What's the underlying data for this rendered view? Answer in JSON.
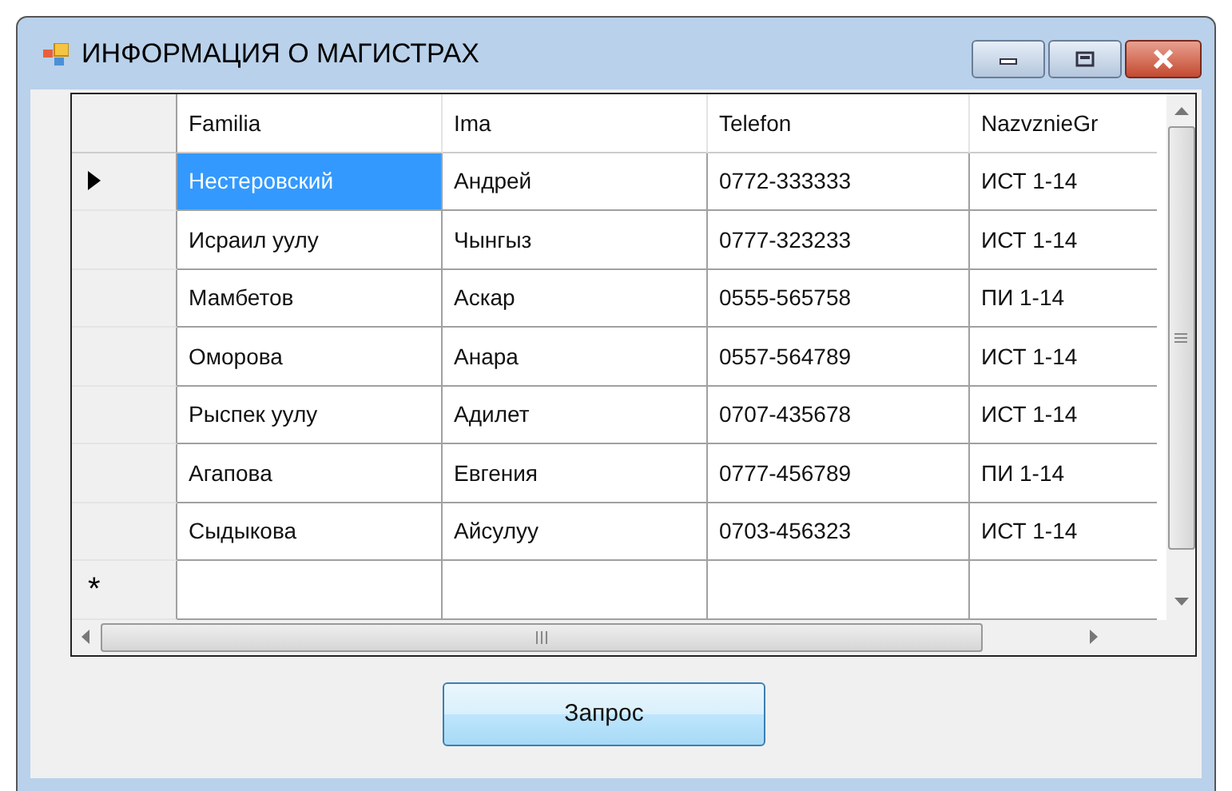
{
  "window": {
    "title": "ИНФОРМАЦИЯ О МАГИСТРАХ"
  },
  "grid": {
    "columns": [
      "Familia",
      "Ima",
      "Telefon",
      "NazvznieGr"
    ],
    "rows": [
      {
        "current": true,
        "cells": [
          {
            "text": "Нестеровский",
            "selected": true
          },
          {
            "text": "Андрей",
            "selected": false
          },
          {
            "text": "0772-333333",
            "selected": false
          },
          {
            "text": "ИСТ 1-14",
            "selected": false
          }
        ]
      },
      {
        "current": false,
        "cells": [
          {
            "text": "Исраил уулу",
            "selected": false
          },
          {
            "text": "Чынгыз",
            "selected": false
          },
          {
            "text": "0777-323233",
            "selected": false
          },
          {
            "text": "ИСТ 1-14",
            "selected": false
          }
        ]
      },
      {
        "current": false,
        "cells": [
          {
            "text": "Мамбетов",
            "selected": false
          },
          {
            "text": "Аскар",
            "selected": false
          },
          {
            "text": "0555-565758",
            "selected": false
          },
          {
            "text": "ПИ 1-14",
            "selected": false
          }
        ]
      },
      {
        "current": false,
        "cells": [
          {
            "text": "Оморова",
            "selected": false
          },
          {
            "text": "Анара",
            "selected": false
          },
          {
            "text": "0557-564789",
            "selected": false
          },
          {
            "text": "ИСТ 1-14",
            "selected": false
          }
        ]
      },
      {
        "current": false,
        "cells": [
          {
            "text": "Рыспек уулу",
            "selected": false
          },
          {
            "text": "Адилет",
            "selected": false
          },
          {
            "text": "0707-435678",
            "selected": false
          },
          {
            "text": "ИСТ 1-14",
            "selected": false
          }
        ]
      },
      {
        "current": false,
        "cells": [
          {
            "text": "Агапова",
            "selected": false
          },
          {
            "text": "Евгения",
            "selected": false
          },
          {
            "text": "0777-456789",
            "selected": false
          },
          {
            "text": "ПИ 1-14",
            "selected": false
          }
        ]
      },
      {
        "current": false,
        "cells": [
          {
            "text": "Сыдыкова",
            "selected": false
          },
          {
            "text": "Айсулуу",
            "selected": false
          },
          {
            "text": "0703-456323",
            "selected": false
          },
          {
            "text": "ИСТ 1-14",
            "selected": false
          }
        ]
      }
    ],
    "new_row_marker": "*"
  },
  "buttons": [
    "Запрос"
  ]
}
